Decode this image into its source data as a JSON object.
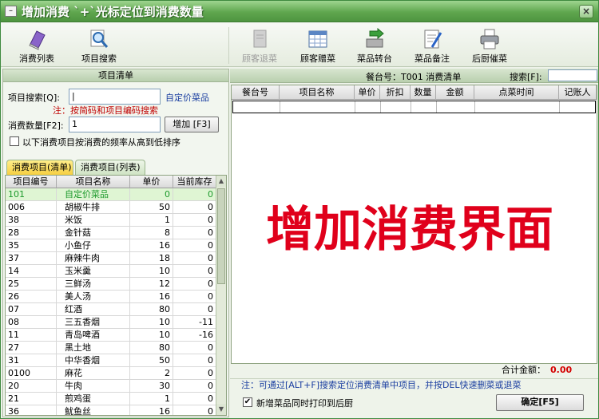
{
  "window": {
    "title": "增加消费 `+`光标定位到消费数量",
    "close": "×",
    "sys": "–"
  },
  "toolbar": [
    {
      "label": "消费列表",
      "icon": "book-icon",
      "enabled": true
    },
    {
      "label": "项目搜索",
      "icon": "magnifier-icon",
      "enabled": true
    },
    {
      "label": "顾客退菜",
      "icon": "return-dish-icon",
      "enabled": false
    },
    {
      "label": "顾客赠菜",
      "icon": "calendar-icon",
      "enabled": true
    },
    {
      "label": "菜品转台",
      "icon": "transfer-icon",
      "enabled": true
    },
    {
      "label": "菜品备注",
      "icon": "note-icon",
      "enabled": true
    },
    {
      "label": "后厨催菜",
      "icon": "printer-icon",
      "enabled": true
    }
  ],
  "left": {
    "header": "项目清单",
    "search_label": "项目搜索[Q]:",
    "search_value": "|",
    "custom_link": "自定价菜品",
    "hint": "注：按简码和项目编码搜索",
    "qty_label": "消费数量[F2]:",
    "qty_value": "1",
    "add_button": "增加 [F3]",
    "sort_label": "以下消费项目按消费的频率从高到低排序",
    "tabs": [
      "消费项目(清单)",
      "消费项目(列表)"
    ],
    "columns": [
      "项目编号",
      "项目名称",
      "单价",
      "当前库存"
    ],
    "rows": [
      {
        "code": "101",
        "name": "自定价菜品",
        "price": "0",
        "stock": "0"
      },
      {
        "code": "006",
        "name": "胡椒牛排",
        "price": "50",
        "stock": "0"
      },
      {
        "code": "38",
        "name": "米饭",
        "price": "1",
        "stock": "0"
      },
      {
        "code": "28",
        "name": "金针菇",
        "price": "8",
        "stock": "0"
      },
      {
        "code": "35",
        "name": "小鱼仔",
        "price": "16",
        "stock": "0"
      },
      {
        "code": "37",
        "name": "麻辣牛肉",
        "price": "18",
        "stock": "0"
      },
      {
        "code": "14",
        "name": "玉米羹",
        "price": "10",
        "stock": "0"
      },
      {
        "code": "25",
        "name": "三鲜汤",
        "price": "12",
        "stock": "0"
      },
      {
        "code": "26",
        "name": "美人汤",
        "price": "16",
        "stock": "0"
      },
      {
        "code": "07",
        "name": "红酒",
        "price": "80",
        "stock": "0"
      },
      {
        "code": "08",
        "name": "三五香烟",
        "price": "10",
        "stock": "-11"
      },
      {
        "code": "11",
        "name": "青岛啤酒",
        "price": "10",
        "stock": "-16"
      },
      {
        "code": "27",
        "name": "黑土地",
        "price": "80",
        "stock": "0"
      },
      {
        "code": "31",
        "name": "中华香烟",
        "price": "50",
        "stock": "0"
      },
      {
        "code": "0100",
        "name": "麻花",
        "price": "2",
        "stock": "0"
      },
      {
        "code": "20",
        "name": "牛肉",
        "price": "30",
        "stock": "0"
      },
      {
        "code": "21",
        "name": "煎鸡蛋",
        "price": "1",
        "stock": "0"
      },
      {
        "code": "36",
        "name": "鱿鱼丝",
        "price": "16",
        "stock": "0"
      }
    ]
  },
  "right": {
    "table_caption": "餐台号：T001 消费清单",
    "search_label": "搜索[F]:",
    "columns": [
      "餐台号",
      "项目名称",
      "单价",
      "折扣",
      "数量",
      "金额",
      "点菜时间",
      "记账人"
    ],
    "total_label": "合计金额：",
    "total_value": "0.00",
    "note": "注：可通过[ALT+F]搜索定位消费清单中项目，并按DEL快速删菜或退菜",
    "print_label": "新增菜品同时打印到后厨",
    "print_checked": true,
    "confirm_button": "确定[F5]"
  },
  "overlay": {
    "text": "增加消费界面",
    "color": "#e0001b"
  },
  "colors": {
    "accent": "#5fa64e",
    "selected_row_text": "#1d9a2c",
    "hint": "#c00000",
    "link": "#1a3ea0"
  }
}
